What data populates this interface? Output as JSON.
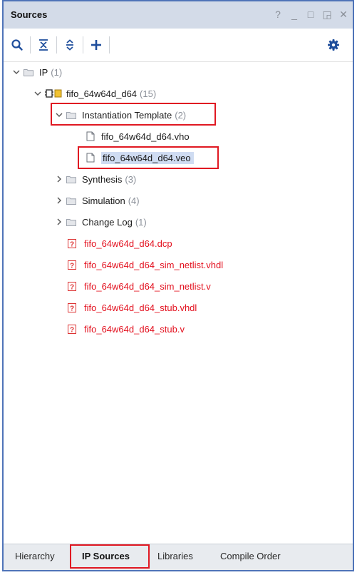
{
  "panel": {
    "title": "Sources"
  },
  "window_controls": [
    "?",
    "_",
    "□",
    "◲",
    "✕"
  ],
  "toolbar": {
    "icons": [
      "search-icon",
      "collapse-all-icon",
      "expand-all-icon",
      "add-icon",
      "gear-icon"
    ]
  },
  "tree": {
    "ip": {
      "label": "IP",
      "count": "(1)"
    },
    "core": {
      "label": "fifo_64w64d_d64",
      "count": "(15)"
    },
    "inst_template": {
      "label": "Instantiation Template",
      "count": "(2)"
    },
    "vho": {
      "label": "fifo_64w64d_d64.vho"
    },
    "veo": {
      "label": "fifo_64w64d_d64.veo"
    },
    "synthesis": {
      "label": "Synthesis",
      "count": "(3)"
    },
    "simulation": {
      "label": "Simulation",
      "count": "(4)"
    },
    "changelog": {
      "label": "Change Log",
      "count": "(1)"
    },
    "missing": [
      "fifo_64w64d_d64.dcp",
      "fifo_64w64d_d64_sim_netlist.vhdl",
      "fifo_64w64d_d64_sim_netlist.v",
      "fifo_64w64d_d64_stub.vhdl",
      "fifo_64w64d_d64_stub.v"
    ]
  },
  "tabs": [
    "Hierarchy",
    "IP Sources",
    "Libraries",
    "Compile Order"
  ],
  "colors": {
    "accent": "#4f74b8",
    "missing_file": "#e3101e",
    "highlight": "#e01822",
    "selection": "#cfdcf2"
  }
}
